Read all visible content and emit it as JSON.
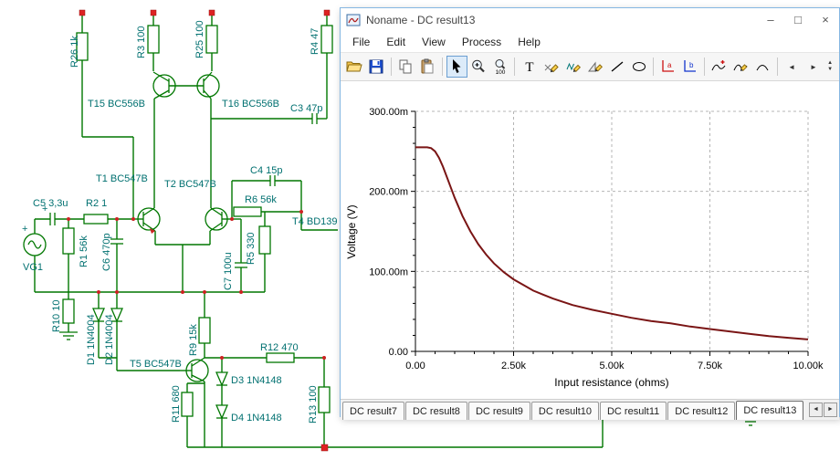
{
  "window": {
    "title": "Noname - DC result13",
    "menu": [
      "File",
      "Edit",
      "View",
      "Process",
      "Help"
    ],
    "controls": {
      "minimize": "–",
      "maximize": "□",
      "close": "×"
    }
  },
  "toolbar": {
    "text_tool_glyph": "T",
    "zoom_level": "100",
    "axis_a_glyph": "a",
    "axis_b_glyph": "b",
    "nav_left_glyph": "◄",
    "nav_right_glyph": "►",
    "spin_up_glyph": "▲",
    "spin_down_glyph": "▼"
  },
  "chart_data": {
    "type": "line",
    "title": "",
    "xlabel": "Input resistance (ohms)",
    "ylabel": "Voltage (V)",
    "xlim": [
      0,
      10000
    ],
    "ylim": [
      0,
      0.3
    ],
    "grid": true,
    "legend": false,
    "line_color": "#7a1515",
    "x_ticks": [
      {
        "v": 0,
        "label": "0.00"
      },
      {
        "v": 2500,
        "label": "2.50k"
      },
      {
        "v": 5000,
        "label": "5.00k"
      },
      {
        "v": 7500,
        "label": "7.50k"
      },
      {
        "v": 10000,
        "label": "10.00k"
      }
    ],
    "y_ticks": [
      {
        "v": 0,
        "label": "0.00"
      },
      {
        "v": 0.1,
        "label": "100.00m"
      },
      {
        "v": 0.2,
        "label": "200.00m"
      },
      {
        "v": 0.3,
        "label": "300.00m"
      }
    ],
    "series": [
      {
        "name": "DC result13",
        "x": [
          0,
          100,
          200,
          300,
          400,
          500,
          600,
          700,
          800,
          900,
          1000,
          1200,
          1400,
          1600,
          1800,
          2000,
          2250,
          2500,
          2750,
          3000,
          3250,
          3500,
          4000,
          4500,
          5000,
          5500,
          6000,
          6500,
          7000,
          7500,
          8000,
          8500,
          9000,
          9500,
          10000
        ],
        "y": [
          0.255,
          0.255,
          0.255,
          0.255,
          0.254,
          0.25,
          0.242,
          0.231,
          0.218,
          0.205,
          0.192,
          0.169,
          0.15,
          0.134,
          0.121,
          0.11,
          0.099,
          0.09,
          0.083,
          0.076,
          0.071,
          0.066,
          0.058,
          0.052,
          0.047,
          0.042,
          0.038,
          0.035,
          0.031,
          0.028,
          0.025,
          0.022,
          0.019,
          0.017,
          0.015
        ]
      }
    ]
  },
  "tab_bar": {
    "tabs": [
      {
        "label": "DC result7",
        "active": false
      },
      {
        "label": "DC result8",
        "active": false
      },
      {
        "label": "DC result9",
        "active": false
      },
      {
        "label": "DC result10",
        "active": false
      },
      {
        "label": "DC result11",
        "active": false
      },
      {
        "label": "DC result12",
        "active": false
      },
      {
        "label": "DC result13",
        "active": true
      }
    ],
    "nav_left": "◄",
    "nav_right": "►"
  },
  "circuit": {
    "wire_color": "#007700",
    "label_color": "#007070",
    "junction_color": "#cc2222",
    "vg1_plus": "+",
    "c5_plus": "+",
    "labels": [
      {
        "t": "R26 1k"
      },
      {
        "t": "R3 100"
      },
      {
        "t": "R25 100"
      },
      {
        "t": "R4 47"
      },
      {
        "t": "T15 BC556B"
      },
      {
        "t": "T16 BC556B"
      },
      {
        "t": "C3 47p"
      },
      {
        "t": "T1 BC547B"
      },
      {
        "t": "T2 BC547B"
      },
      {
        "t": "C4 15p"
      },
      {
        "t": "R6 56k"
      },
      {
        "t": "T4 BD139"
      },
      {
        "t": "C5 3,3u"
      },
      {
        "t": "R2 1"
      },
      {
        "t": "VG1"
      },
      {
        "t": "R1 56k"
      },
      {
        "t": "C6 470p"
      },
      {
        "t": "R5 330"
      },
      {
        "t": "C7 100u"
      },
      {
        "t": "R10 10"
      },
      {
        "t": "D1 1N4004"
      },
      {
        "t": "D2 1N4004"
      },
      {
        "t": "T5 BC547B"
      },
      {
        "t": "R9 15k"
      },
      {
        "t": "R12 470"
      },
      {
        "t": "D3 1N4148"
      },
      {
        "t": "D4 1N4148"
      },
      {
        "t": "R11 680"
      },
      {
        "t": "R13 100"
      }
    ]
  }
}
